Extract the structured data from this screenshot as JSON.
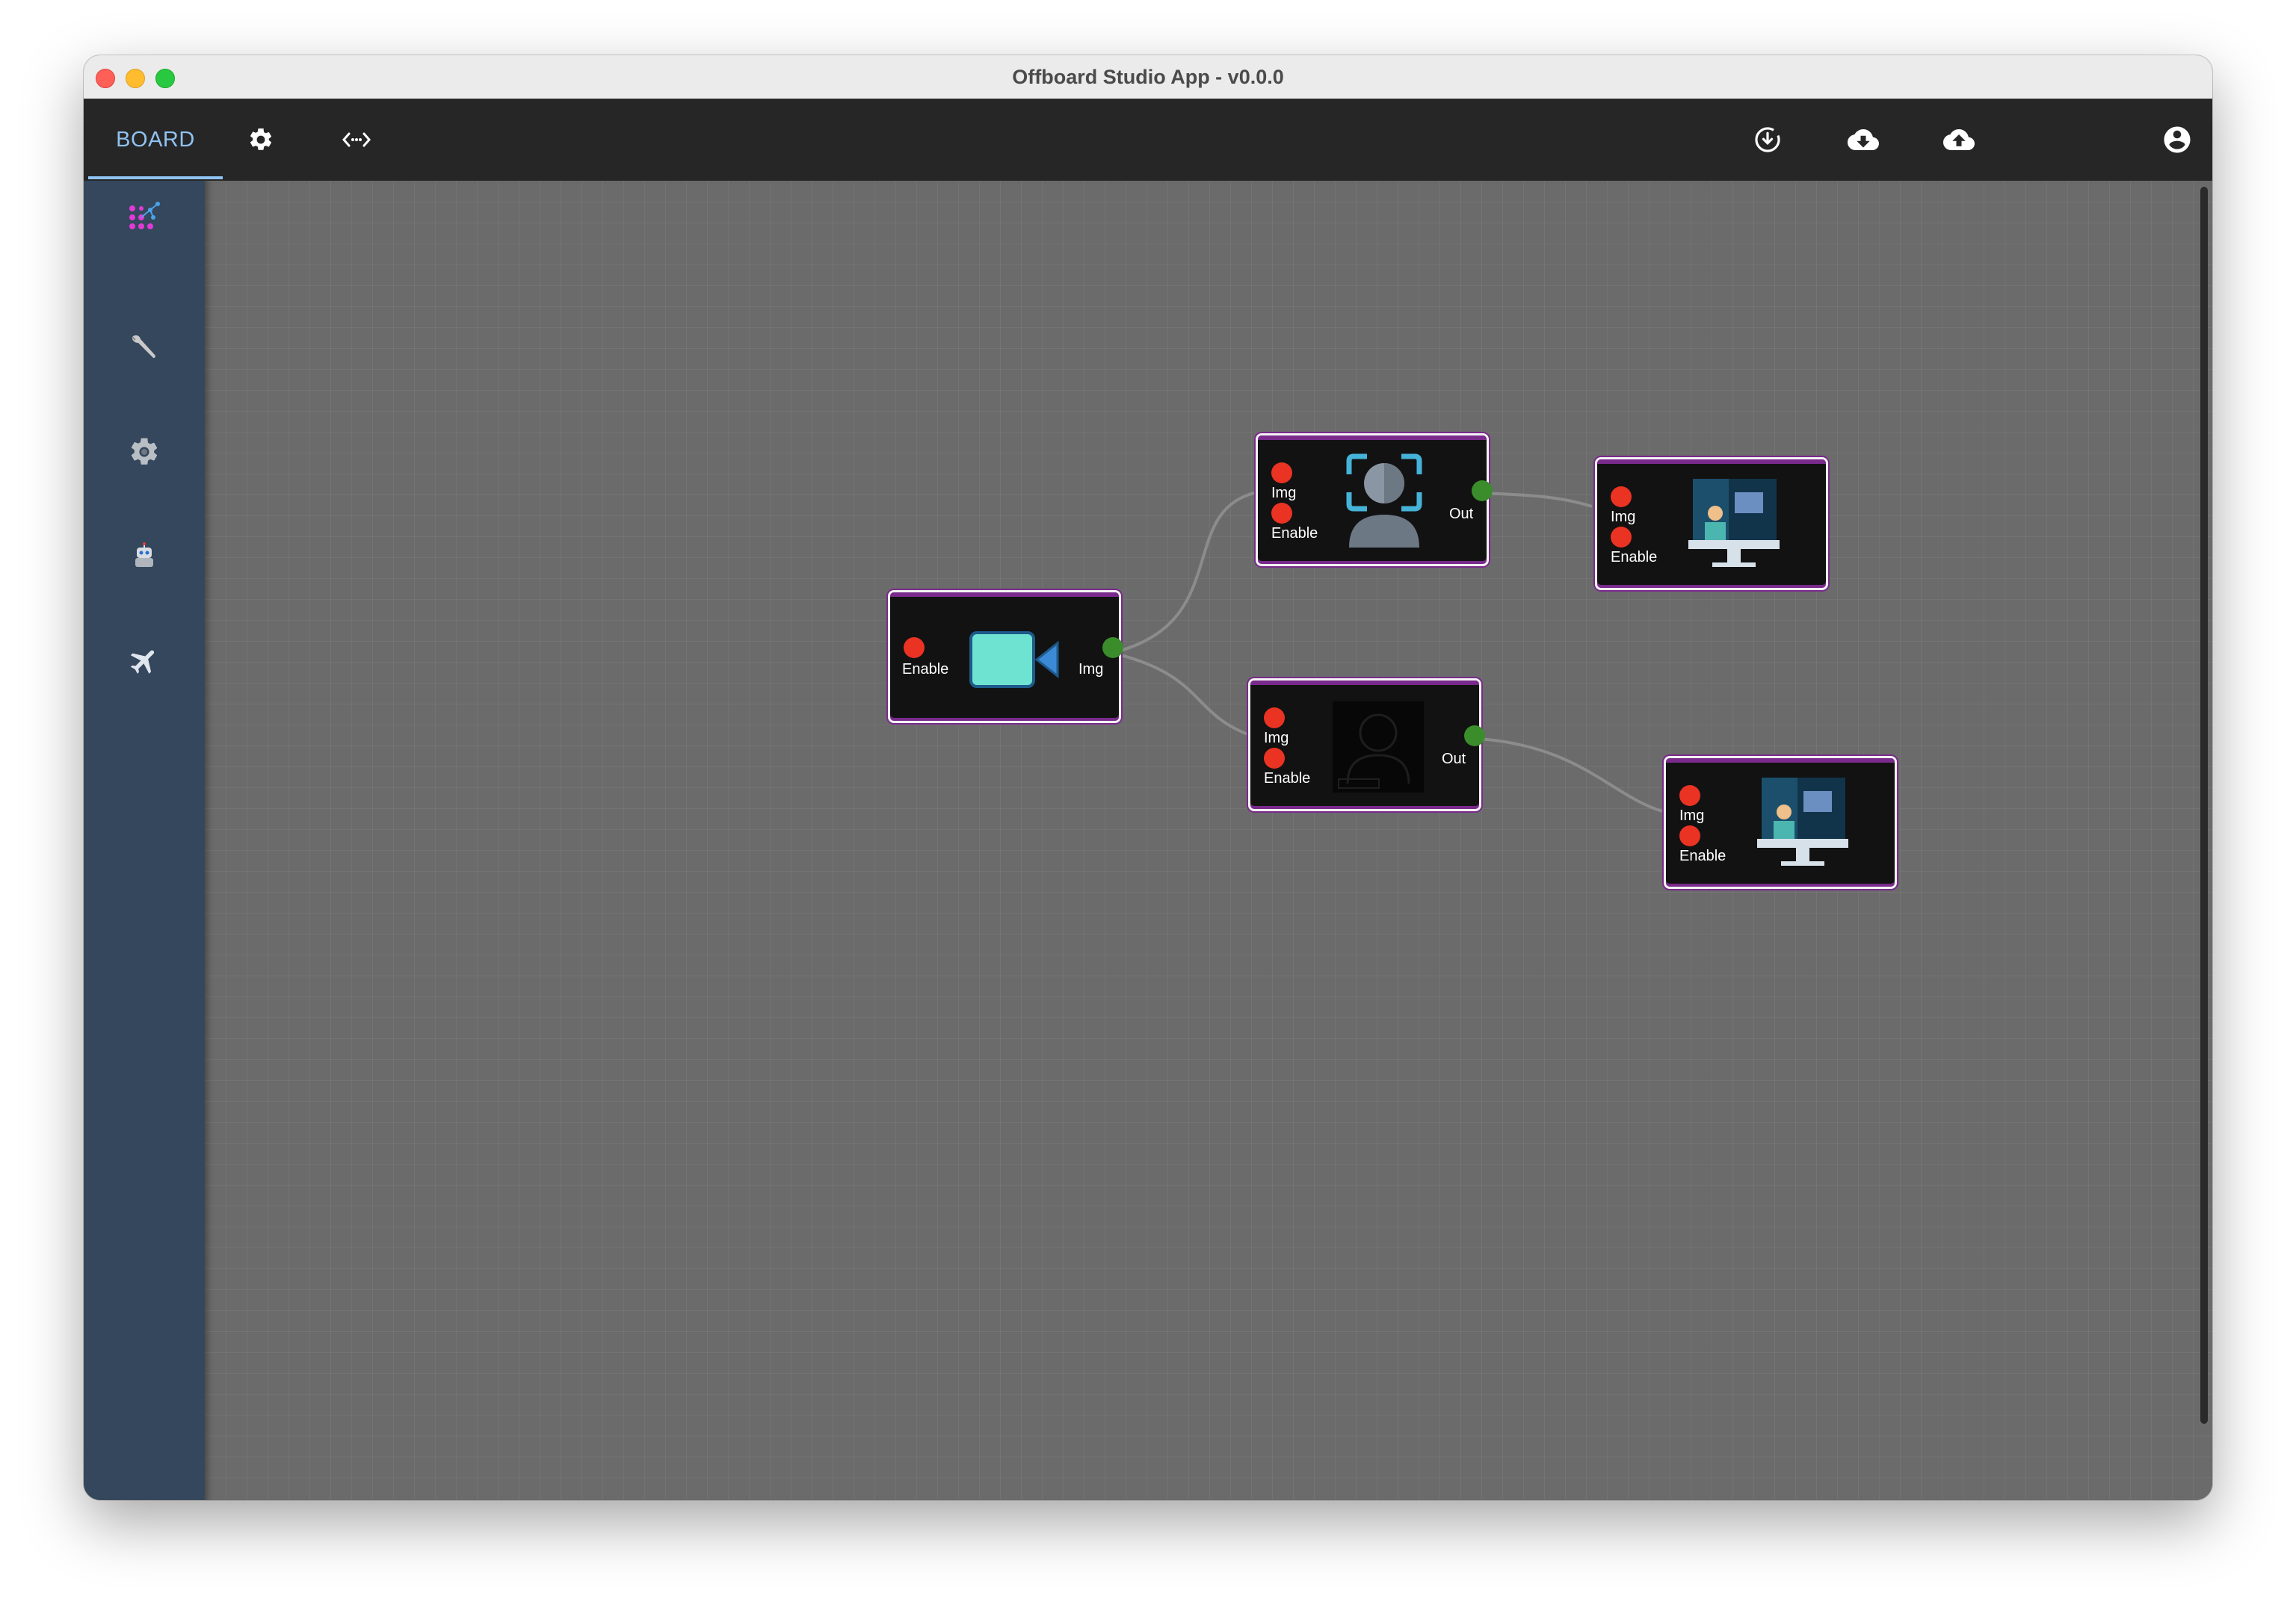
{
  "window": {
    "title": "Offboard Studio App - v0.0.0"
  },
  "toolbar": {
    "tab_board": "BOARD",
    "icons": [
      "settings-gear-icon",
      "code-arrows-icon",
      "download-circle-icon",
      "cloud-download-icon",
      "cloud-upload-icon",
      "account-icon"
    ]
  },
  "sidebar": {
    "items": [
      {
        "icon": "network-graph-icon"
      },
      {
        "icon": "wrench-icon"
      },
      {
        "icon": "gear-icon"
      },
      {
        "icon": "robot-icon"
      },
      {
        "icon": "airplane-icon"
      }
    ]
  },
  "nodes": [
    {
      "id": "camera",
      "icon": "video-camera-icon",
      "inputs": [
        "Enable"
      ],
      "outputs": [
        "Img"
      ]
    },
    {
      "id": "face-detector",
      "icon": "face-recognition-icon",
      "inputs": [
        "Img",
        "Enable"
      ],
      "outputs": [
        "Out"
      ]
    },
    {
      "id": "face-mask",
      "icon": "person-silhouette-icon",
      "inputs": [
        "Img",
        "Enable"
      ],
      "outputs": [
        "Out"
      ]
    },
    {
      "id": "display-1",
      "icon": "monitor-display-icon",
      "inputs": [
        "Img",
        "Enable"
      ],
      "outputs": []
    },
    {
      "id": "display-2",
      "icon": "monitor-display-icon",
      "inputs": [
        "Img",
        "Enable"
      ],
      "outputs": []
    }
  ],
  "colors": {
    "accent": "#8fc3f2",
    "toolbar_bg": "#262626",
    "sidebar_bg": "#34475c",
    "canvas_bg": "#6b6b6b",
    "port_input": "#ea3323",
    "port_output": "#3a8d2a",
    "node_border_accent": "#7a2a8c"
  }
}
